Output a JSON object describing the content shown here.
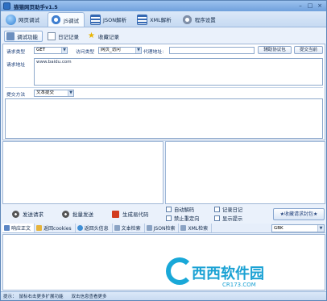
{
  "window": {
    "title": "猫猫网页助手v1.5"
  },
  "main_tabs": [
    {
      "label": "网页调试",
      "icon": "globe-icon"
    },
    {
      "label": "JS调试",
      "icon": "gear-icon"
    },
    {
      "label": "JSON解析",
      "icon": "grid-icon"
    },
    {
      "label": "XML解析",
      "icon": "grid-icon"
    },
    {
      "label": "程序设置",
      "icon": "settings-icon"
    }
  ],
  "sub_tabs": [
    {
      "label": "调试功能"
    },
    {
      "label": "日记记录"
    },
    {
      "label": "收藏记录"
    }
  ],
  "form": {
    "request_type_label": "请求类型",
    "request_type_value": "GET",
    "access_type_label": "访问类型",
    "access_type_value": "网页_访问",
    "proxy_label": "代理地址:",
    "proxy_value": "",
    "hint_proxy_button": "辅助协议包",
    "submit_button": "提交当前",
    "url_label": "请求地址",
    "url_value": "www.baidu.com",
    "submit_method_label": "提交方法",
    "submit_method_value": "文本提交"
  },
  "actions": {
    "send_request": "发送请求",
    "batch_send": "批量发送",
    "generate_code": "生成易代码",
    "auto_decode": "自动解码",
    "record_log": "记录日记",
    "no_redirect": "禁止重定向",
    "show_hint": "显示提示",
    "fav_button": "★收藏请求封包★"
  },
  "result_tabs": [
    {
      "label": "响应正文"
    },
    {
      "label": "返回cookies"
    },
    {
      "label": "返回头信息"
    },
    {
      "label": "文本检索"
    },
    {
      "label": "JSON检索"
    },
    {
      "label": "XML检索"
    }
  ],
  "encoding": {
    "value": "GBK"
  },
  "watermark": {
    "text": "西西软件园",
    "sub": "CR173.COM"
  },
  "status": {
    "prefix": "提示：",
    "message1": "鼠标右击更多扩展功能",
    "message2": "双击信息查看更多"
  },
  "colors": {
    "accent": "#2d6fc2",
    "watermark": "#1ba2d4",
    "title_bar": "#6fa0dc"
  }
}
